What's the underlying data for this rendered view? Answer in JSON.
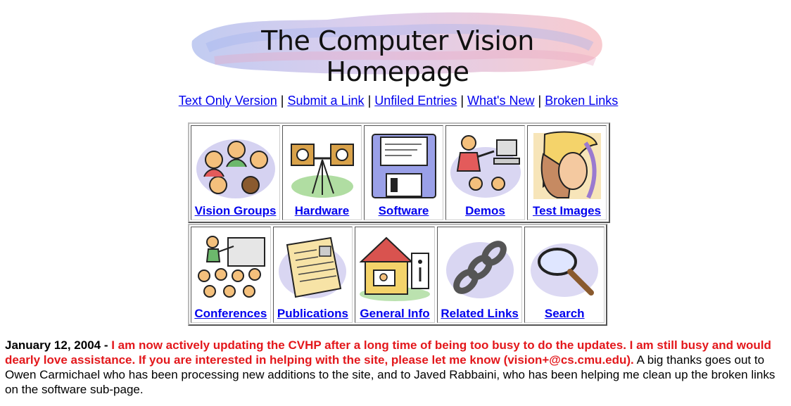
{
  "banner": {
    "title": "The Computer Vision Homepage"
  },
  "topnav": {
    "links": [
      "Text Only Version",
      "Submit a Link",
      "Unfiled Entries",
      "What's New",
      "Broken Links"
    ],
    "separator": "|"
  },
  "icon_row1": [
    {
      "label": "Vision Groups",
      "icon": "people-group-icon"
    },
    {
      "label": "Hardware",
      "icon": "camera-tripod-icon"
    },
    {
      "label": "Software",
      "icon": "floppy-disk-icon"
    },
    {
      "label": "Demos",
      "icon": "presenter-computer-icon"
    },
    {
      "label": "Test Images",
      "icon": "lena-portrait-icon"
    }
  ],
  "icon_row2": [
    {
      "label": "Conferences",
      "icon": "lecture-audience-icon"
    },
    {
      "label": "Publications",
      "icon": "paper-document-icon"
    },
    {
      "label": "General Info",
      "icon": "info-booth-icon"
    },
    {
      "label": "Related Links",
      "icon": "chain-links-icon"
    },
    {
      "label": "Search",
      "icon": "magnifying-glass-icon"
    }
  ],
  "news": {
    "date": "January 12, 2004 -",
    "urgent": "I am now actively updating the CVHP after a long time of being too busy to do the updates. I am still busy and would dearly love assistance. If you are interested in helping with the site, please let me know (vision+@cs.cmu.edu).",
    "body": "A big thanks goes out to Owen Carmichael who has been processing new additions to the site, and to Javed Rabbaini, who has been helping me clean up the broken links on the software sub-page."
  },
  "colors": {
    "link": "#0000ee",
    "urgent": "#e3171b"
  }
}
